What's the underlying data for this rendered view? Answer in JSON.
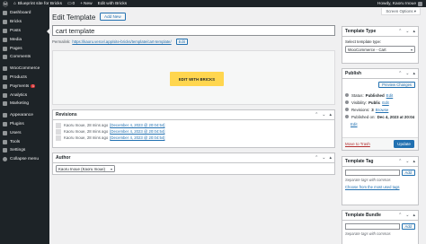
{
  "adminbar": {
    "site_name": "Blueprint site for Bricks",
    "comments_count": "0",
    "new_label": "New",
    "edit_with_bricks": "Edit with Bricks",
    "howdy": "Howdy, Kaoru Inoue"
  },
  "sidebar": {
    "items": [
      {
        "label": "Dashboard",
        "icon": "dashboard-icon"
      },
      {
        "label": "Bricks",
        "icon": "bricks-icon"
      },
      {
        "label": "Posts",
        "icon": "pushpin-icon"
      },
      {
        "label": "Media",
        "icon": "media-icon"
      },
      {
        "label": "Pages",
        "icon": "pages-icon"
      },
      {
        "label": "Comments",
        "icon": "comment-icon"
      },
      {
        "label": "WooCommerce",
        "icon": "woocommerce-icon"
      },
      {
        "label": "Products",
        "icon": "archive-icon"
      },
      {
        "label": "Payments",
        "icon": "payments-icon",
        "badge": "1"
      },
      {
        "label": "Analytics",
        "icon": "chart-icon"
      },
      {
        "label": "Marketing",
        "icon": "megaphone-icon"
      },
      {
        "label": "Appearance",
        "icon": "paintbrush-icon"
      },
      {
        "label": "Plugins",
        "icon": "plugin-icon"
      },
      {
        "label": "Users",
        "icon": "users-icon"
      },
      {
        "label": "Tools",
        "icon": "wrench-icon"
      },
      {
        "label": "Settings",
        "icon": "settings-icon"
      },
      {
        "label": "Collapse menu",
        "icon": "collapse-icon"
      }
    ]
  },
  "screen_options": "Screen Options ▾",
  "page": {
    "title": "Edit Template",
    "add_new": "Add New",
    "post_title": "cart template",
    "permalink_label": "Permalink:",
    "permalink_url": "https://kaoru.vercel.app/site-bricks/template/cart-template/",
    "permalink_edit": "Edit",
    "edit_with_bricks": "EDIT WITH BRICKS"
  },
  "revisions": {
    "heading": "Revisions",
    "rows": [
      {
        "author": "Kaoru Inoue,",
        "ago": "28 mins ago",
        "date": "[December 4, 2023 @ 20:04:54]"
      },
      {
        "author": "Kaoru Inoue,",
        "ago": "28 mins ago",
        "date": "[December 4, 2023 @ 20:04:54]"
      },
      {
        "author": "Kaoru Inoue,",
        "ago": "28 mins ago",
        "date": "[December 4, 2023 @ 20:04:54]"
      }
    ]
  },
  "author_box": {
    "heading": "Author",
    "value": "Kaoru Inoue (Kaoru Inoue)"
  },
  "template_type": {
    "heading": "Template Type",
    "label": "Select template type:",
    "value": "WooCommerce - Cart"
  },
  "publish": {
    "heading": "Publish",
    "preview": "Preview Changes",
    "status_label": "Status:",
    "status_value": "Published",
    "status_edit": "Edit",
    "visibility_label": "Visibility:",
    "visibility_value": "Public",
    "visibility_edit": "Edit",
    "revisions_label": "Revisions:",
    "revisions_count": "3",
    "revisions_browse": "Browse",
    "published_label": "Published on:",
    "published_value": "Dec 4, 2023 at 20:04",
    "published_edit": "Edit",
    "trash": "Move to Trash",
    "update": "Update"
  },
  "template_tag": {
    "heading": "Template Tag",
    "add": "Add",
    "hint": "Separate tags with commas",
    "choose": "Choose from the most used tags"
  },
  "template_bundle": {
    "heading": "Template Bundle",
    "add": "Add",
    "hint": "Separate tags with commas"
  },
  "colors": {
    "accent": "#2271b1",
    "admin_bg": "#1d2327",
    "bricks_yellow": "#ffd64f",
    "danger": "#b32d2e"
  }
}
